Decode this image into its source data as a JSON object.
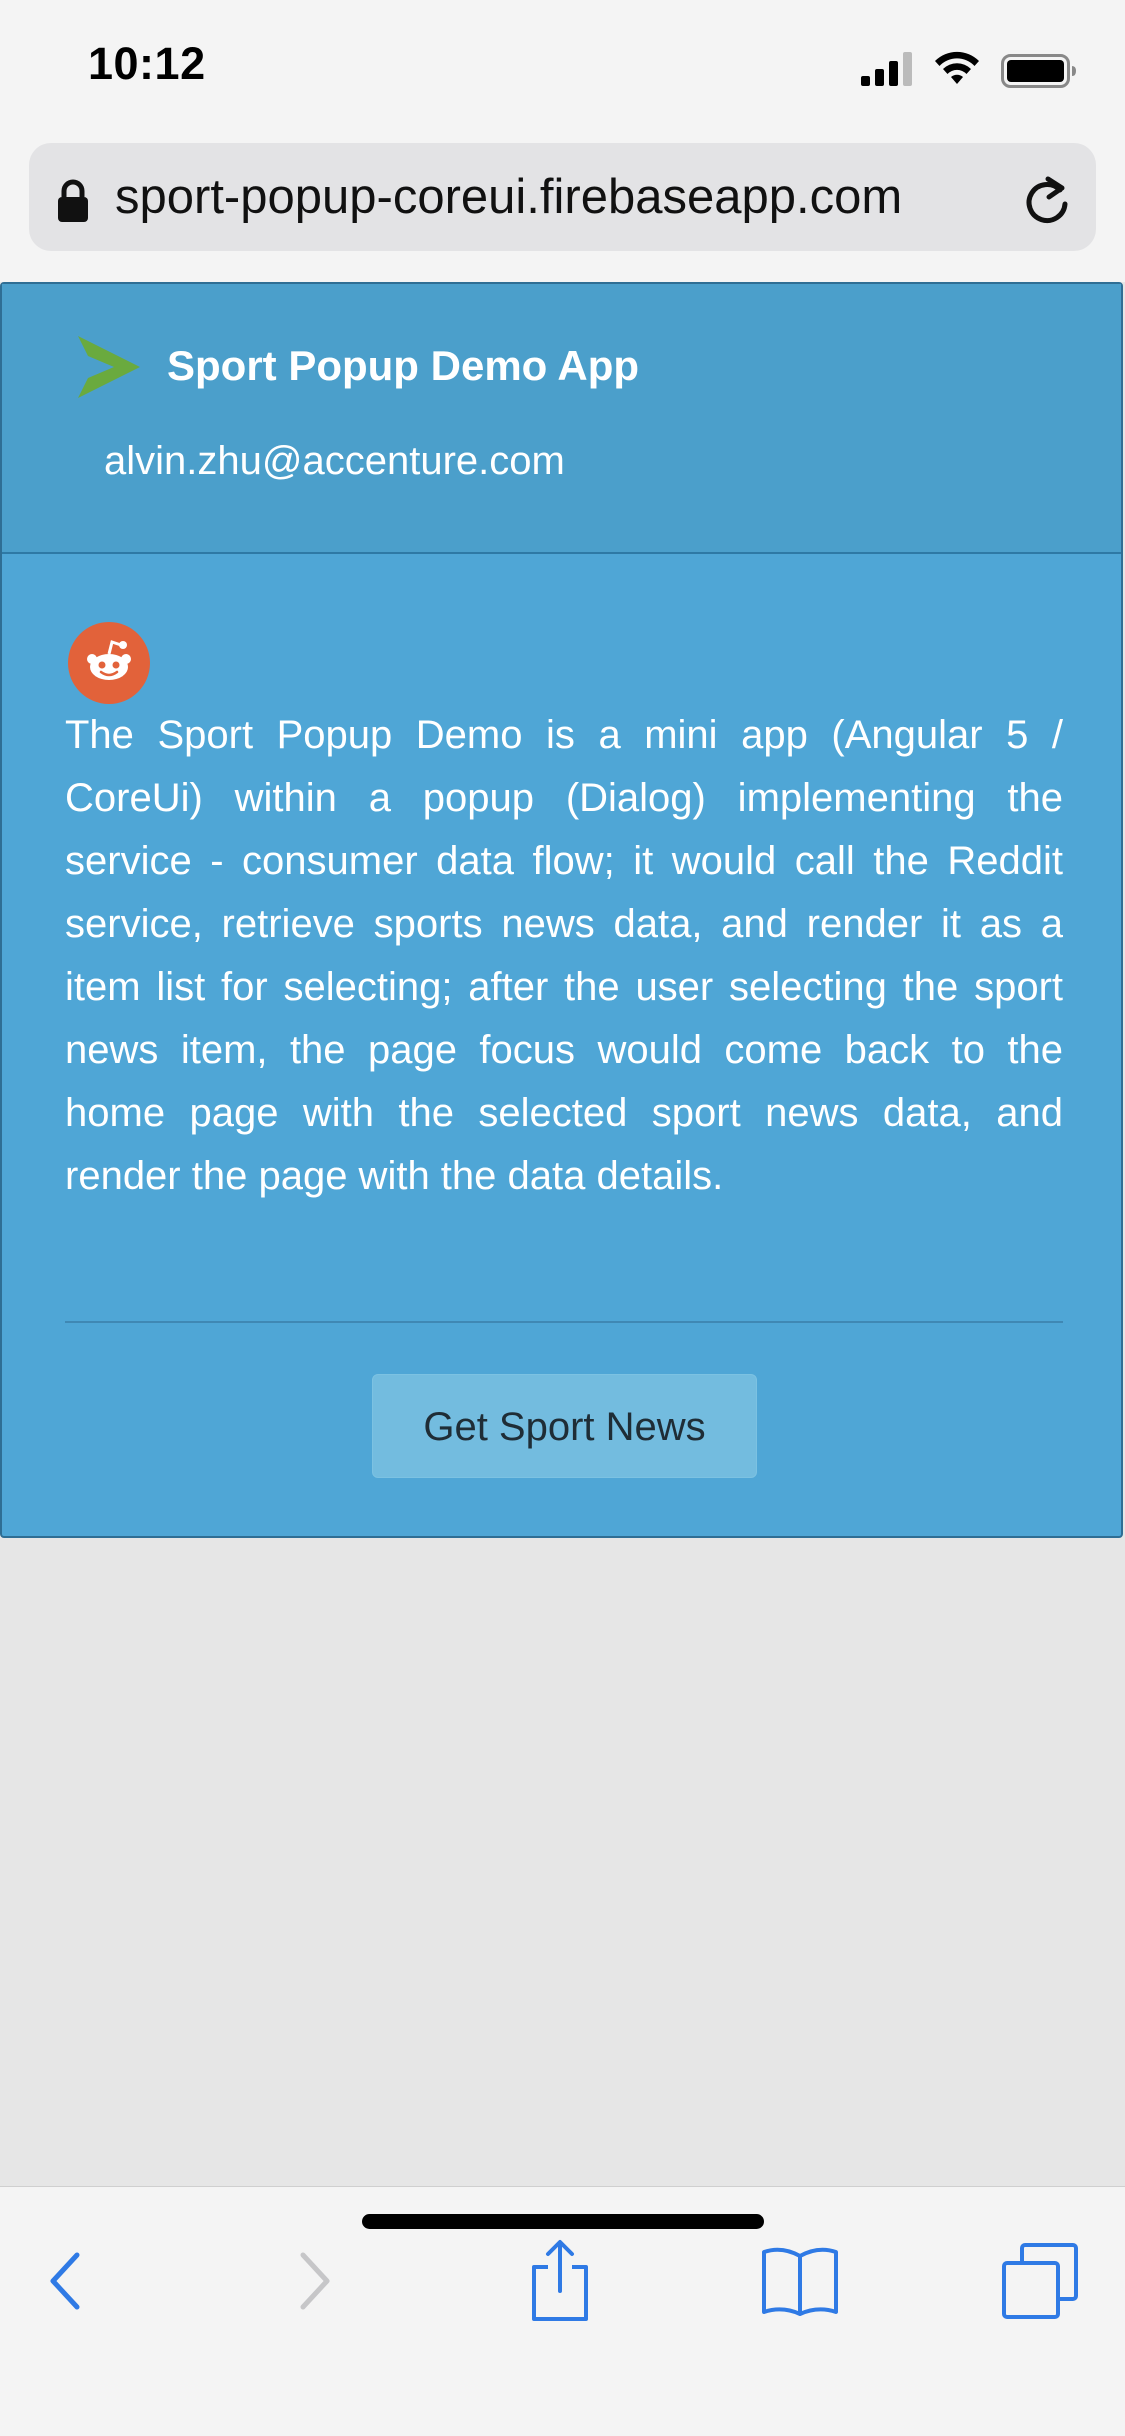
{
  "status_bar": {
    "time": "10:12",
    "icons": [
      "signal-icon",
      "wifi-icon",
      "battery-icon"
    ]
  },
  "browser": {
    "url": "sport-popup-coreui.firebaseapp.com",
    "icons": [
      "lock-icon",
      "reload-icon"
    ]
  },
  "card": {
    "title": "Sport Popup Demo App",
    "email": "alvin.zhu@accenture.com",
    "description": "The Sport Popup Demo is a mini app (Angular 5 / CoreUi) within a popup (Dialog) implementing the service - consumer data flow; it would call the Reddit service, retrieve sports news data, and render it as a item list for selecting; after the user selecting the sport news item, the page focus would come back to the home page with the selected sport news data, and render the page with the data details.",
    "button_label": "Get Sport News",
    "colors": {
      "card_background": "#4fa6d6",
      "header_background": "#4b9fcb",
      "button_background": "#73bcdf",
      "brand_chevron": "#6aaa3e",
      "reddit_orange": "#e2623a"
    }
  },
  "toolbar": {
    "items": [
      "back-icon",
      "forward-icon",
      "share-icon",
      "bookmarks-icon",
      "tabs-icon"
    ],
    "accent_color": "#2f7ae5"
  }
}
